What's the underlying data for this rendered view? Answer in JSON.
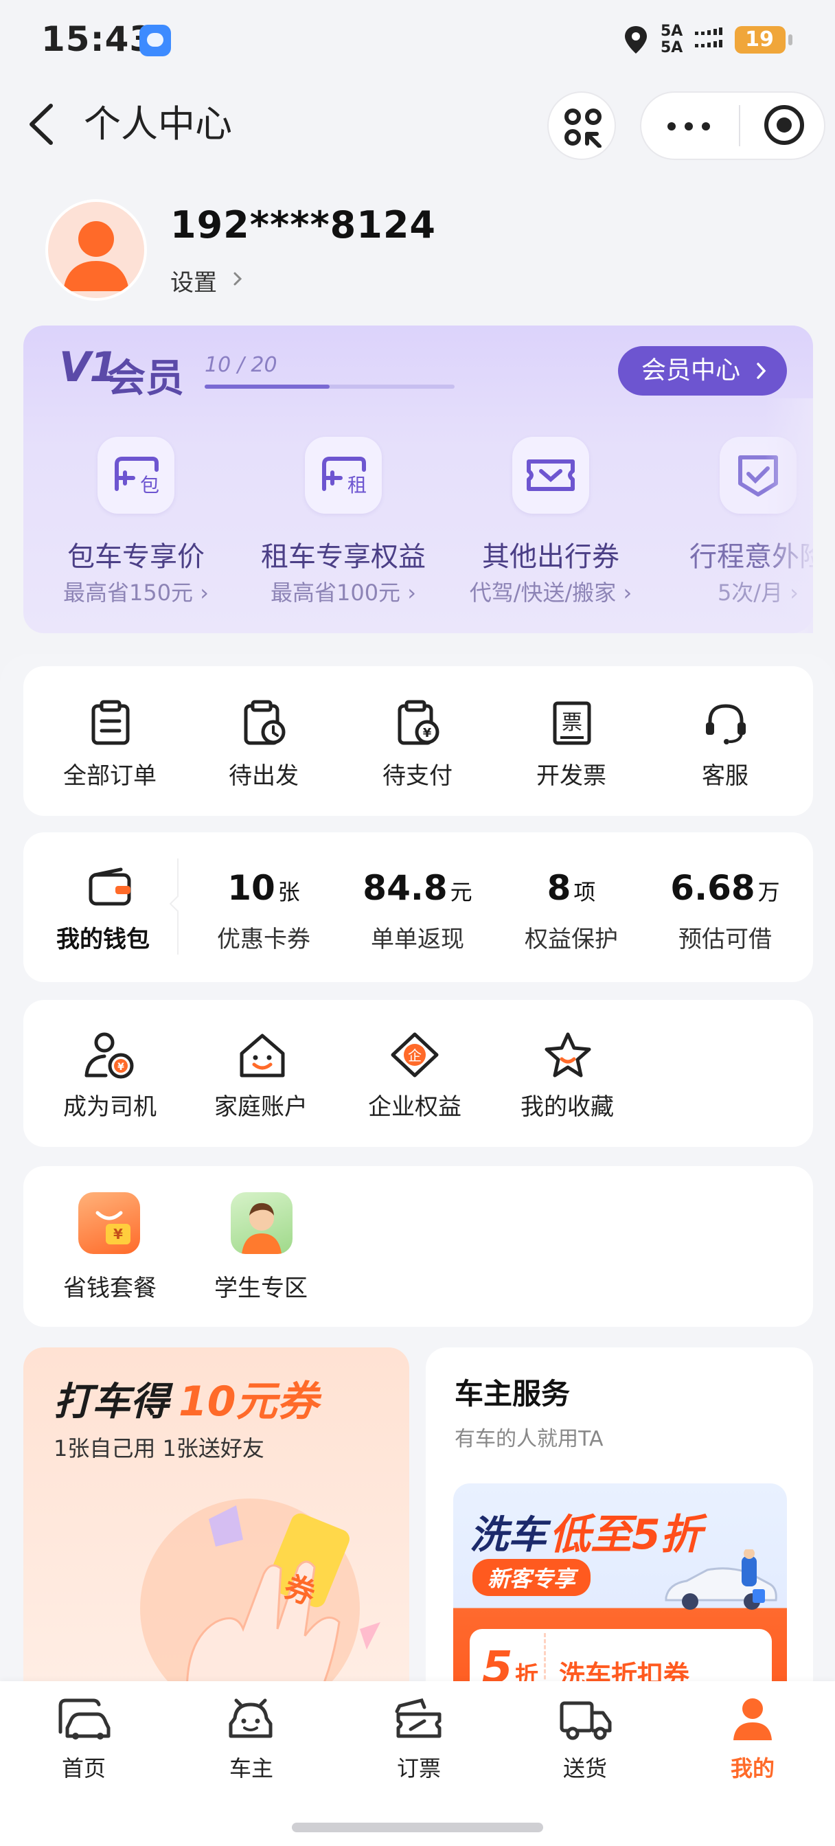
{
  "status_bar": {
    "time": "15:43",
    "network_line1": "5A",
    "network_line2": "5A",
    "battery": "19"
  },
  "nav": {
    "title": "个人中心"
  },
  "profile": {
    "username": "192****8124",
    "settings_label": "设置"
  },
  "member": {
    "level_badge": "V1",
    "level_suffix": "会员",
    "progress_text": "10 / 20",
    "progress_fraction": 0.5,
    "center_button": "会员中心",
    "benefits": [
      {
        "icon": "charter-car-icon",
        "title": "包车专享价",
        "subtitle": "最高省150元"
      },
      {
        "icon": "rental-car-icon",
        "title": "租车专享权益",
        "subtitle": "最高省100元"
      },
      {
        "icon": "travel-coupon-icon",
        "title": "其他出行券",
        "subtitle": "代驾/快送/搬家"
      },
      {
        "icon": "trip-insurance-icon",
        "title": "行程意外险",
        "subtitle": "5次/月"
      }
    ]
  },
  "orders": [
    {
      "icon": "clipboard-icon",
      "label": "全部订单"
    },
    {
      "icon": "clock-clipboard-icon",
      "label": "待出发"
    },
    {
      "icon": "yuan-clipboard-icon",
      "label": "待支付"
    },
    {
      "icon": "invoice-icon",
      "label": "开发票"
    },
    {
      "icon": "headset-icon",
      "label": "客服"
    }
  ],
  "wallet": {
    "label": "我的钱包",
    "stats": [
      {
        "value": "10",
        "unit": "张",
        "label": "优惠卡券"
      },
      {
        "value": "84.8",
        "unit": "元",
        "label": "单单返现"
      },
      {
        "value": "8",
        "unit": "项",
        "label": "权益保护"
      },
      {
        "value": "6.68",
        "unit": "万",
        "label": "预估可借"
      }
    ]
  },
  "services": [
    {
      "icon": "driver-icon",
      "label": "成为司机"
    },
    {
      "icon": "family-house-icon",
      "label": "家庭账户"
    },
    {
      "icon": "enterprise-icon",
      "label": "企业权益"
    },
    {
      "icon": "star-icon",
      "label": "我的收藏"
    }
  ],
  "mini_apps": [
    {
      "icon": "savings-bag-icon",
      "label": "省钱套餐"
    },
    {
      "icon": "student-avatar-icon",
      "label": "学生专区"
    }
  ],
  "promo_left": {
    "title_part1": "打车得",
    "title_part2": "10元券",
    "subtitle": "1张自己用 1张送好友",
    "ticket_char": "券"
  },
  "promo_right": {
    "title": "车主服务",
    "subtitle": "有车的人就用TA",
    "banner_title_a": "洗车",
    "banner_title_b": "低至5折",
    "banner_tag": "新客专享",
    "coupon_value": "5",
    "coupon_unit": "折",
    "coupon_text": "洗车折扣券"
  },
  "tabs": [
    {
      "icon": "home-car-icon",
      "label": "首页",
      "active": false
    },
    {
      "icon": "car-owner-icon",
      "label": "车主",
      "active": false
    },
    {
      "icon": "ticket-icon",
      "label": "订票",
      "active": false
    },
    {
      "icon": "truck-icon",
      "label": "送货",
      "active": false
    },
    {
      "icon": "person-icon",
      "label": "我的",
      "active": true
    }
  ],
  "colors": {
    "accent": "#ff6a29",
    "member_purple": "#6d55d0",
    "background": "#f3f4f7"
  }
}
